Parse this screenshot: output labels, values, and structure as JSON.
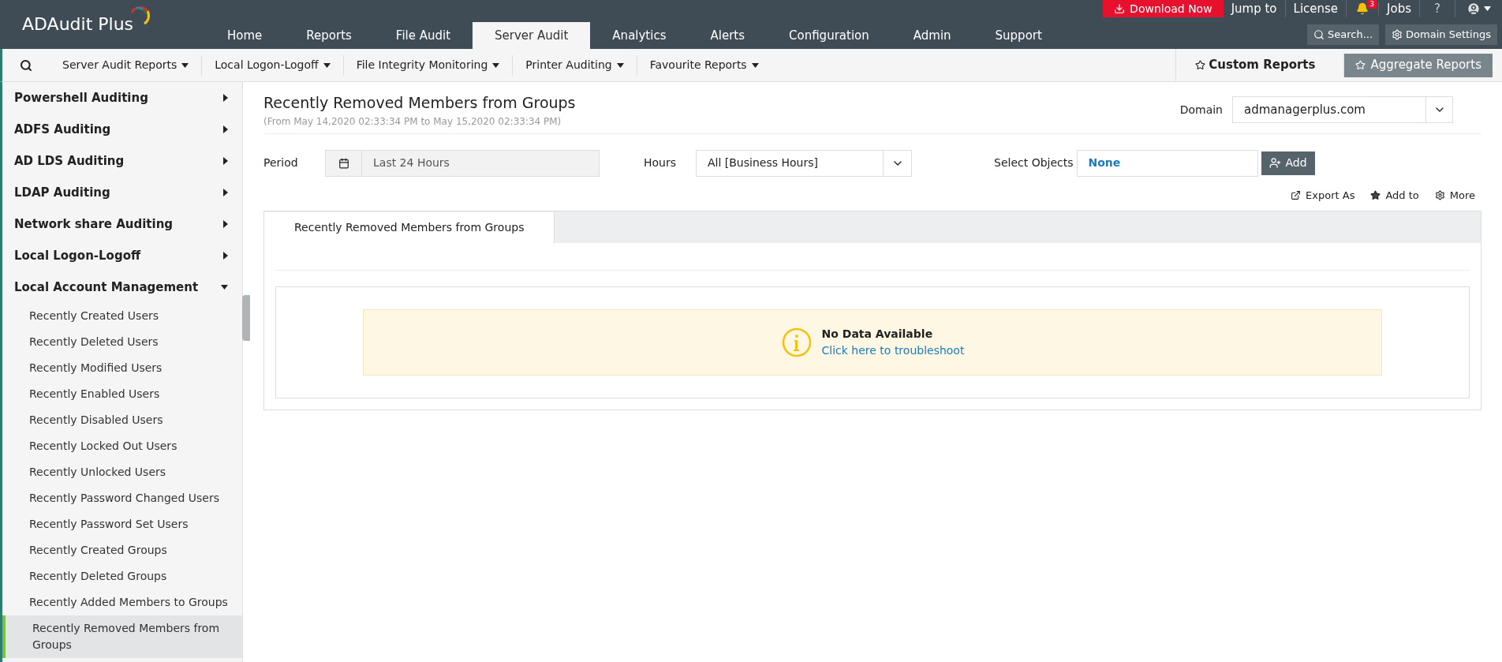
{
  "brand": {
    "name": "ADAudit Plus"
  },
  "top_links": {
    "download": "Download Now",
    "jump": "Jump to",
    "license": "License",
    "notifications": "3",
    "jobs": "Jobs",
    "help": "?"
  },
  "tabs": [
    {
      "label": "Home",
      "selected": false
    },
    {
      "label": "Reports",
      "selected": false
    },
    {
      "label": "File Audit",
      "selected": false
    },
    {
      "label": "Server Audit",
      "selected": true
    },
    {
      "label": "Analytics",
      "selected": false
    },
    {
      "label": "Alerts",
      "selected": false
    },
    {
      "label": "Configuration",
      "selected": false
    },
    {
      "label": "Admin",
      "selected": false
    },
    {
      "label": "Support",
      "selected": false
    }
  ],
  "search_button": "Search...",
  "domain_settings": "Domain Settings",
  "subnav": [
    "Server Audit Reports",
    "Local Logon-Logoff",
    "File Integrity Monitoring",
    "Printer Auditing",
    "Favourite Reports"
  ],
  "custom_reports": "Custom Reports",
  "aggregate_reports": "Aggregate Reports",
  "sidebar": {
    "items": [
      {
        "label": "Powershell Auditing",
        "expanded": false
      },
      {
        "label": "ADFS Auditing",
        "expanded": false
      },
      {
        "label": "AD LDS Auditing",
        "expanded": false
      },
      {
        "label": "LDAP Auditing",
        "expanded": false
      },
      {
        "label": "Network share Auditing",
        "expanded": false
      },
      {
        "label": "Local Logon-Logoff",
        "expanded": false
      },
      {
        "label": "Local Account Management",
        "expanded": true,
        "children": [
          {
            "label": "Recently Created Users",
            "selected": false
          },
          {
            "label": "Recently Deleted Users",
            "selected": false
          },
          {
            "label": "Recently Modified Users",
            "selected": false
          },
          {
            "label": "Recently Enabled Users",
            "selected": false
          },
          {
            "label": "Recently Disabled Users",
            "selected": false
          },
          {
            "label": "Recently Locked Out Users",
            "selected": false
          },
          {
            "label": "Recently Unlocked Users",
            "selected": false
          },
          {
            "label": "Recently Password Changed Users",
            "selected": false
          },
          {
            "label": "Recently Password Set Users",
            "selected": false
          },
          {
            "label": "Recently Created Groups",
            "selected": false
          },
          {
            "label": "Recently Deleted Groups",
            "selected": false
          },
          {
            "label": "Recently Added Members to Groups",
            "selected": false
          },
          {
            "label": "Recently Removed Members from Groups",
            "selected": true
          }
        ]
      }
    ]
  },
  "report": {
    "title": "Recently Removed Members from Groups",
    "range": "(From May 14,2020 02:33:34 PM to May 15,2020 02:33:34 PM)",
    "domain_label": "Domain",
    "domain": "admanagerplus.com",
    "period_label": "Period",
    "period": "Last 24 Hours",
    "hours_label": "Hours",
    "hours": "All [Business Hours]",
    "objects_label": "Select Objects",
    "objects": "None",
    "add": "Add",
    "actions": [
      "Export As",
      "Add to",
      "More"
    ],
    "tab": "Recently Removed Members from Groups",
    "empty_title": "No Data Available",
    "empty_link": "Click here to troubleshoot"
  }
}
